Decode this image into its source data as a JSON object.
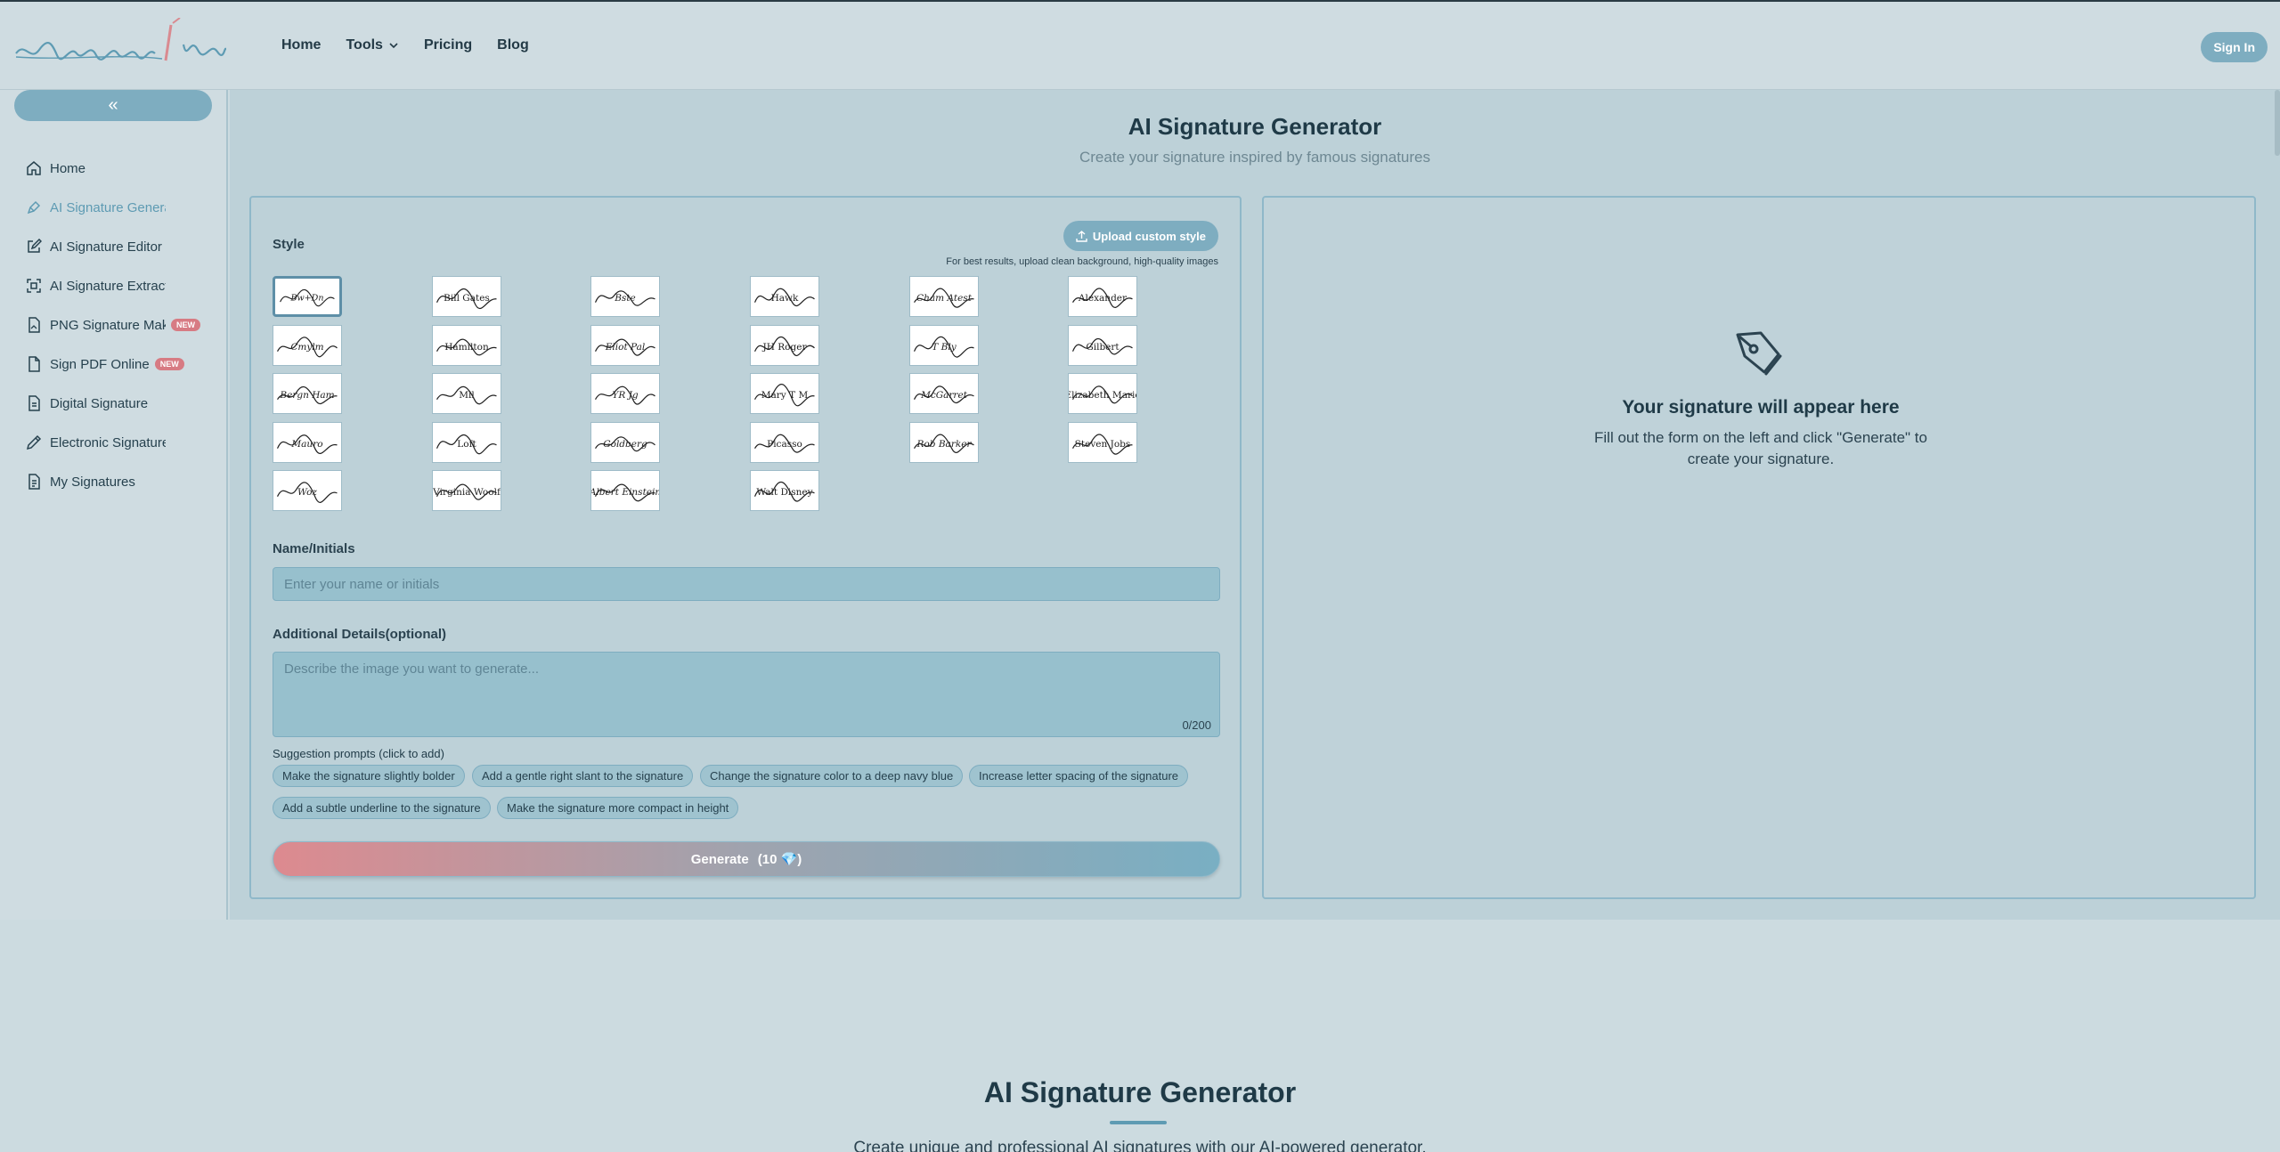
{
  "header": {
    "logo_text": "signature pro",
    "nav": [
      {
        "label": "Home"
      },
      {
        "label": "Tools"
      },
      {
        "label": "Pricing"
      },
      {
        "label": "Blog"
      }
    ],
    "signin_label": "Sign In"
  },
  "sidebar": {
    "collapse_icon": "«",
    "items": [
      {
        "label": "Home",
        "icon": "home-icon"
      },
      {
        "label": "AI Signature Generator",
        "icon": "pen-icon",
        "active": true
      },
      {
        "label": "AI Signature Editor",
        "icon": "edit-icon"
      },
      {
        "label": "AI Signature Extractor",
        "icon": "scan-icon"
      },
      {
        "label": "PNG Signature Maker",
        "icon": "file-image-icon",
        "badge": "NEW"
      },
      {
        "label": "Sign PDF Online",
        "icon": "file-icon",
        "badge": "NEW"
      },
      {
        "label": "Digital Signature",
        "icon": "file-text-icon"
      },
      {
        "label": "Electronic Signature",
        "icon": "pencil-icon"
      },
      {
        "label": "My Signatures",
        "icon": "file-list-icon"
      }
    ]
  },
  "main": {
    "title": "AI Signature Generator",
    "subtitle": "Create your signature inspired by famous signatures"
  },
  "form": {
    "style_label": "Style",
    "upload_label": "Upload custom style",
    "upload_hint": "For best results, upload clean background, high-quality images",
    "name_label": "Name/Initials",
    "name_placeholder": "Enter your name or initials",
    "name_value": "",
    "details_label": "Additional Details(optional)",
    "details_placeholder": "Describe the image you want to generate...",
    "details_value": "",
    "counter": "0/200",
    "suggestions_label": "Suggestion prompts (click to add)",
    "suggestions": [
      "Make the signature slightly bolder",
      "Add a gentle right slant to the signature",
      "Change the signature color to a deep navy blue",
      "Increase letter spacing of the signature",
      "Add a subtle underline to the signature",
      "Make the signature more compact in height"
    ],
    "generate_label": "Generate",
    "generate_credits": "(10 💎)"
  },
  "styles": [
    {
      "text": "Bw+Dn",
      "selected": true
    },
    {
      "text": "Bill Gates"
    },
    {
      "text": "Bste"
    },
    {
      "text": "Hawk"
    },
    {
      "text": "Cham Atest"
    },
    {
      "text": "Alexander"
    },
    {
      "text": "Cmylm"
    },
    {
      "text": "Hamilton"
    },
    {
      "text": "Eliot Pal"
    },
    {
      "text": "JH Roger"
    },
    {
      "text": "T Bly"
    },
    {
      "text": "Gilbert"
    },
    {
      "text": "Bergn Ham"
    },
    {
      "text": "Mll"
    },
    {
      "text": "YR Jg"
    },
    {
      "text": "Mary T M"
    },
    {
      "text": "McGarret"
    },
    {
      "text": "Elizabeth Marie"
    },
    {
      "text": "Mauro"
    },
    {
      "text": "Loft"
    },
    {
      "text": "Goldberg"
    },
    {
      "text": "Picasso"
    },
    {
      "text": "Rob Barker"
    },
    {
      "text": "Steven Jobs"
    },
    {
      "text": "Woz"
    },
    {
      "text": "Virginia Woolf"
    },
    {
      "text": "Albert Einstein"
    },
    {
      "text": "Walt Disney"
    }
  ],
  "result": {
    "icon": "pen-nib-icon",
    "title": "Your signature will appear here",
    "description": "Fill out the form on the left and click \"Generate\" to create your signature."
  },
  "footer_section": {
    "title": "AI Signature Generator",
    "subtitle": "Create unique and professional AI signatures with our AI-powered generator."
  },
  "colors": {
    "accent": "#7eadc0",
    "active_link": "#5e9bb3",
    "badge": "#d77b83",
    "generate_start": "#dd8a8f",
    "generate_end": "#79afc3"
  }
}
